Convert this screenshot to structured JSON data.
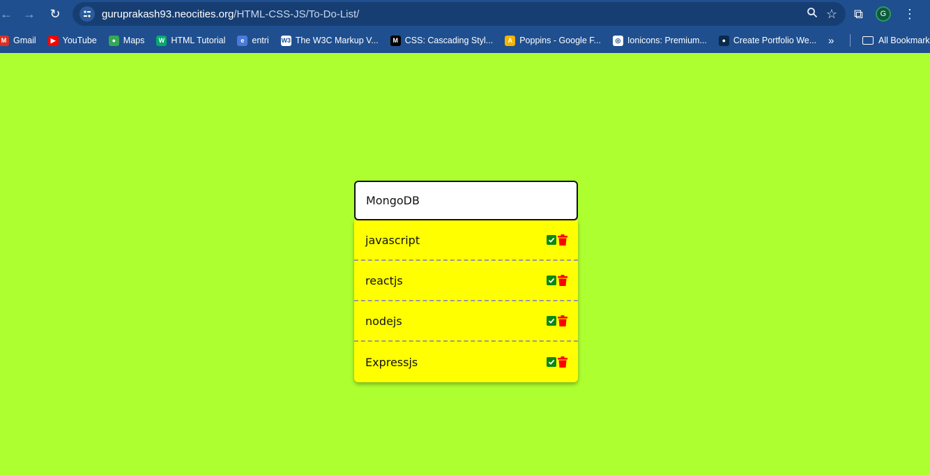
{
  "browser": {
    "url_host": "guruprakash93.neocities.org",
    "url_path": "/HTML-CSS-JS/To-Do-List/",
    "profile_initial": "G"
  },
  "bookmarks": [
    {
      "label": "Gmail",
      "icon": "gmail-icon",
      "color": "#d93025",
      "glyph": "M"
    },
    {
      "label": "YouTube",
      "icon": "youtube-icon",
      "color": "#ff0000",
      "glyph": "▶"
    },
    {
      "label": "Maps",
      "icon": "maps-icon",
      "color": "#34a853",
      "glyph": "●"
    },
    {
      "label": "HTML Tutorial",
      "icon": "w3schools-icon",
      "color": "#04aa6d",
      "glyph": "W"
    },
    {
      "label": "entri",
      "icon": "entri-icon",
      "color": "#4a7bd9",
      "glyph": "e"
    },
    {
      "label": "The W3C Markup V...",
      "icon": "w3c-icon",
      "color": "#ffffff",
      "glyph": "W3"
    },
    {
      "label": "CSS: Cascading Styl...",
      "icon": "mdn-icon",
      "color": "#000000",
      "glyph": "M"
    },
    {
      "label": "Poppins - Google F...",
      "icon": "google-fonts-icon",
      "color": "#f4b400",
      "glyph": "A"
    },
    {
      "label": "Ionicons: Premium...",
      "icon": "ionicons-icon",
      "color": "#ffffff",
      "glyph": "◎"
    },
    {
      "label": "Create Portfolio We...",
      "icon": "portfolio-icon",
      "color": "#0a2a4a",
      "glyph": "●"
    }
  ],
  "all_bookmarks": "All Bookmarks",
  "todo": {
    "input_value": "MongoDB",
    "items": [
      "javascript",
      "reactjs",
      "nodejs",
      "Expressjs"
    ]
  },
  "colors": {
    "page_background": "#adff2f",
    "list_background": "#ffff00",
    "check_green": "#0b8a0b",
    "trash_red": "#ff0000"
  }
}
